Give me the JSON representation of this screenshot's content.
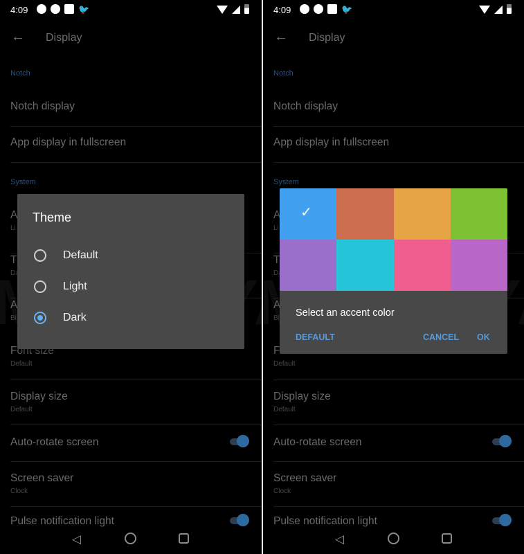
{
  "status_bar": {
    "time": "4:09",
    "icons": [
      "messages-icon",
      "telegram-icon",
      "gallery-icon",
      "twitter-icon"
    ],
    "right_icons": [
      "wifi-icon",
      "no-signal-icon",
      "battery-icon"
    ]
  },
  "header": {
    "title": "Display"
  },
  "settings": [
    {
      "type": "section",
      "label": "Notch"
    },
    {
      "type": "item",
      "title": "Notch display"
    },
    {
      "type": "item",
      "title": "App display in fullscreen"
    },
    {
      "type": "section",
      "label": "System"
    },
    {
      "type": "item",
      "title": "A",
      "subtitle": "Li"
    },
    {
      "type": "item",
      "title": "T",
      "subtitle": "Da"
    },
    {
      "type": "item",
      "title": "A",
      "subtitle": "Bl"
    },
    {
      "type": "item",
      "title": "Font size",
      "subtitle": "Default"
    },
    {
      "type": "item",
      "title": "Display size",
      "subtitle": "Default"
    },
    {
      "type": "item",
      "title": "Auto-rotate screen",
      "toggle": true
    },
    {
      "type": "item",
      "title": "Screen saver",
      "subtitle": "Clock"
    },
    {
      "type": "item",
      "title": "Pulse notification light",
      "toggle": true
    }
  ],
  "theme_dialog": {
    "title": "Theme",
    "options": [
      {
        "label": "Default",
        "selected": false
      },
      {
        "label": "Light",
        "selected": false
      },
      {
        "label": "Dark",
        "selected": true
      }
    ]
  },
  "accent_dialog": {
    "colors": [
      "#42a0f0",
      "#cd6e4e",
      "#e6a444",
      "#7cc232",
      "#9a6fcc",
      "#26c5d9",
      "#ef5e8e",
      "#b967c7"
    ],
    "selected_index": 0,
    "message": "Select an accent color",
    "default_label": "DEFAULT",
    "cancel_label": "CANCEL",
    "ok_label": "OK"
  },
  "watermark": "MOBIGYAAN",
  "nav": [
    "back-icon",
    "home-icon",
    "recents-icon"
  ],
  "accent": "#42a0f0"
}
